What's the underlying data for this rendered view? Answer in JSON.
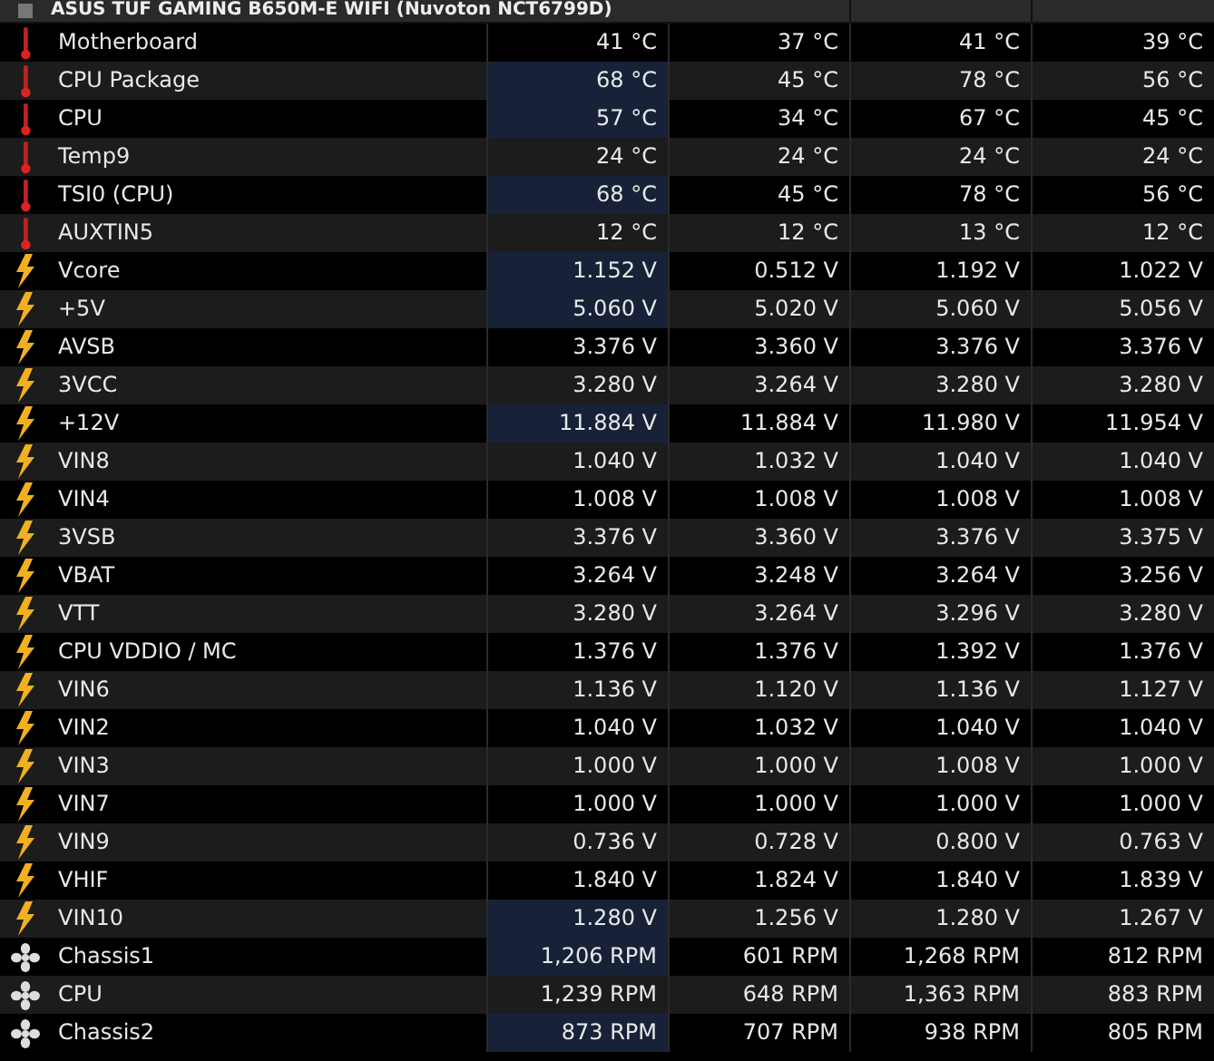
{
  "device": {
    "title": "ASUS TUF GAMING B650M-E WIFI (Nuvoton NCT6799D)"
  },
  "sensors": [
    {
      "kind": "temperature",
      "name": "Motherboard",
      "highlighted": false,
      "current": "41 °C",
      "minimum": "37 °C",
      "maximum": "41 °C",
      "average": "39 °C"
    },
    {
      "kind": "temperature",
      "name": "CPU Package",
      "highlighted": true,
      "current": "68 °C",
      "minimum": "45 °C",
      "maximum": "78 °C",
      "average": "56 °C"
    },
    {
      "kind": "temperature",
      "name": "CPU",
      "highlighted": true,
      "current": "57 °C",
      "minimum": "34 °C",
      "maximum": "67 °C",
      "average": "45 °C"
    },
    {
      "kind": "temperature",
      "name": "Temp9",
      "highlighted": false,
      "current": "24 °C",
      "minimum": "24 °C",
      "maximum": "24 °C",
      "average": "24 °C"
    },
    {
      "kind": "temperature",
      "name": "TSI0 (CPU)",
      "highlighted": true,
      "current": "68 °C",
      "minimum": "45 °C",
      "maximum": "78 °C",
      "average": "56 °C"
    },
    {
      "kind": "temperature",
      "name": "AUXTIN5",
      "highlighted": false,
      "current": "12 °C",
      "minimum": "12 °C",
      "maximum": "13 °C",
      "average": "12 °C"
    },
    {
      "kind": "voltage",
      "name": "Vcore",
      "highlighted": true,
      "current": "1.152 V",
      "minimum": "0.512 V",
      "maximum": "1.192 V",
      "average": "1.022 V"
    },
    {
      "kind": "voltage",
      "name": "+5V",
      "highlighted": true,
      "current": "5.060 V",
      "minimum": "5.020 V",
      "maximum": "5.060 V",
      "average": "5.056 V"
    },
    {
      "kind": "voltage",
      "name": "AVSB",
      "highlighted": false,
      "current": "3.376 V",
      "minimum": "3.360 V",
      "maximum": "3.376 V",
      "average": "3.376 V"
    },
    {
      "kind": "voltage",
      "name": "3VCC",
      "highlighted": false,
      "current": "3.280 V",
      "minimum": "3.264 V",
      "maximum": "3.280 V",
      "average": "3.280 V"
    },
    {
      "kind": "voltage",
      "name": "+12V",
      "highlighted": true,
      "current": "11.884 V",
      "minimum": "11.884 V",
      "maximum": "11.980 V",
      "average": "11.954 V"
    },
    {
      "kind": "voltage",
      "name": "VIN8",
      "highlighted": false,
      "current": "1.040 V",
      "minimum": "1.032 V",
      "maximum": "1.040 V",
      "average": "1.040 V"
    },
    {
      "kind": "voltage",
      "name": "VIN4",
      "highlighted": false,
      "current": "1.008 V",
      "minimum": "1.008 V",
      "maximum": "1.008 V",
      "average": "1.008 V"
    },
    {
      "kind": "voltage",
      "name": "3VSB",
      "highlighted": false,
      "current": "3.376 V",
      "minimum": "3.360 V",
      "maximum": "3.376 V",
      "average": "3.375 V"
    },
    {
      "kind": "voltage",
      "name": "VBAT",
      "highlighted": false,
      "current": "3.264 V",
      "minimum": "3.248 V",
      "maximum": "3.264 V",
      "average": "3.256 V"
    },
    {
      "kind": "voltage",
      "name": "VTT",
      "highlighted": false,
      "current": "3.280 V",
      "minimum": "3.264 V",
      "maximum": "3.296 V",
      "average": "3.280 V"
    },
    {
      "kind": "voltage",
      "name": "CPU VDDIO / MC",
      "highlighted": false,
      "current": "1.376 V",
      "minimum": "1.376 V",
      "maximum": "1.392 V",
      "average": "1.376 V"
    },
    {
      "kind": "voltage",
      "name": "VIN6",
      "highlighted": false,
      "current": "1.136 V",
      "minimum": "1.120 V",
      "maximum": "1.136 V",
      "average": "1.127 V"
    },
    {
      "kind": "voltage",
      "name": "VIN2",
      "highlighted": false,
      "current": "1.040 V",
      "minimum": "1.032 V",
      "maximum": "1.040 V",
      "average": "1.040 V"
    },
    {
      "kind": "voltage",
      "name": "VIN3",
      "highlighted": false,
      "current": "1.000 V",
      "minimum": "1.000 V",
      "maximum": "1.008 V",
      "average": "1.000 V"
    },
    {
      "kind": "voltage",
      "name": "VIN7",
      "highlighted": false,
      "current": "1.000 V",
      "minimum": "1.000 V",
      "maximum": "1.000 V",
      "average": "1.000 V"
    },
    {
      "kind": "voltage",
      "name": "VIN9",
      "highlighted": false,
      "current": "0.736 V",
      "minimum": "0.728 V",
      "maximum": "0.800 V",
      "average": "0.763 V"
    },
    {
      "kind": "voltage",
      "name": "VHIF",
      "highlighted": false,
      "current": "1.840 V",
      "minimum": "1.824 V",
      "maximum": "1.840 V",
      "average": "1.839 V"
    },
    {
      "kind": "voltage",
      "name": "VIN10",
      "highlighted": true,
      "current": "1.280 V",
      "minimum": "1.256 V",
      "maximum": "1.280 V",
      "average": "1.267 V"
    },
    {
      "kind": "fan",
      "name": "Chassis1",
      "highlighted": true,
      "current": "1,206 RPM",
      "minimum": "601 RPM",
      "maximum": "1,268 RPM",
      "average": "812 RPM"
    },
    {
      "kind": "fan",
      "name": "CPU",
      "highlighted": false,
      "current": "1,239 RPM",
      "minimum": "648 RPM",
      "maximum": "1,363 RPM",
      "average": "883 RPM"
    },
    {
      "kind": "fan",
      "name": "Chassis2",
      "highlighted": true,
      "current": "873 RPM",
      "minimum": "707 RPM",
      "maximum": "938 RPM",
      "average": "805 RPM"
    }
  ]
}
